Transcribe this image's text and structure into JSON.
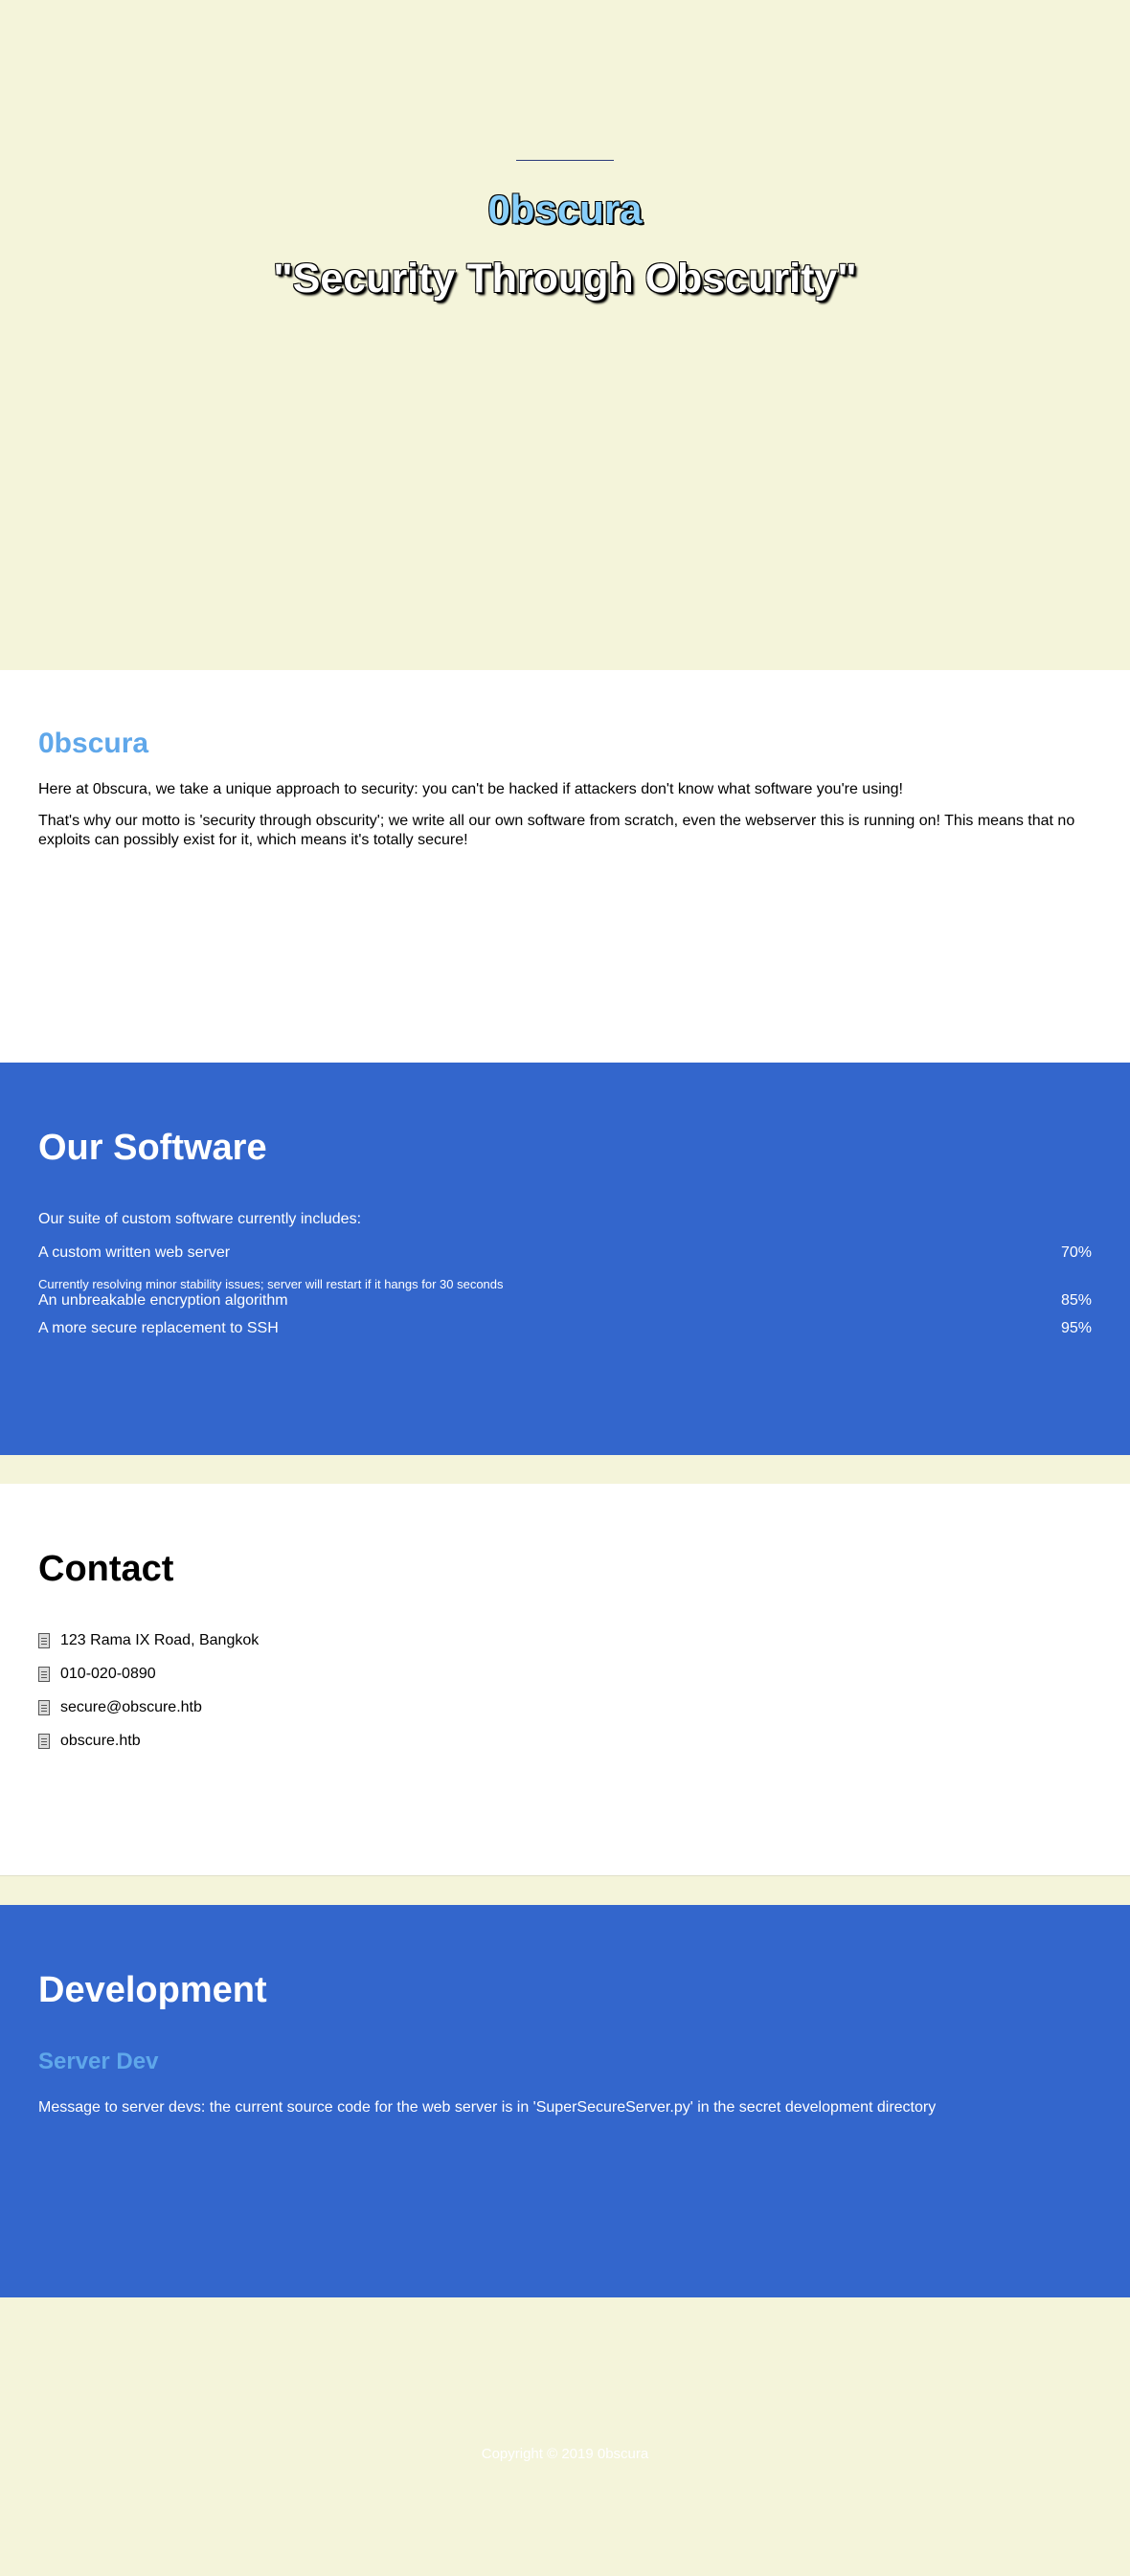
{
  "hero": {
    "brand": "0bscura",
    "tagline": "\"Security Through Obscurity\""
  },
  "about": {
    "title": "0bscura",
    "paragraph1": "Here at 0bscura, we take a unique approach to security: you can't be hacked if attackers don't know what software you're using!",
    "paragraph2": "That's why our motto is 'security through obscurity'; we write all our own software from scratch, even the webserver this is running on! This means that no exploits can possibly exist for it, which means it's totally secure!"
  },
  "software": {
    "title": "Our Software",
    "intro": "Our suite of custom software currently includes:",
    "items": [
      {
        "name": "A custom written web server",
        "percent": "70%"
      },
      {
        "name": "An unbreakable encryption algorithm",
        "percent": "85%"
      },
      {
        "name": "A more secure replacement to SSH",
        "percent": "95%"
      }
    ],
    "note": "Currently resolving minor stability issues; server will restart if it hangs for 30 seconds"
  },
  "contact": {
    "title": "Contact",
    "items": [
      {
        "icon": "document-icon",
        "text": "123 Rama IX Road, Bangkok"
      },
      {
        "icon": "document-icon",
        "text": "010-020-0890"
      },
      {
        "icon": "document-icon",
        "text": "secure@obscure.htb"
      },
      {
        "icon": "document-icon",
        "text": "obscure.htb"
      }
    ]
  },
  "development": {
    "title": "Development",
    "subtitle": "Server Dev",
    "message": "Message to server devs: the current source code for the web server is in 'SuperSecureServer.py' in the secret development directory"
  },
  "footer": {
    "copyright": "Copyright © 2019 0bscura"
  },
  "colors": {
    "cream": "#f4f4da",
    "blue": "#3366cc",
    "light_blue": "#5fa7ea",
    "brand_cyan": "#87cefa"
  }
}
